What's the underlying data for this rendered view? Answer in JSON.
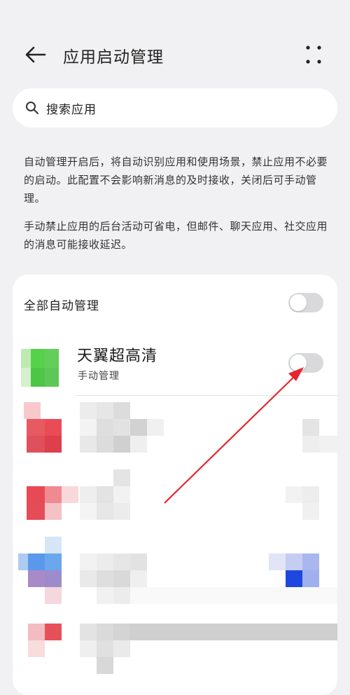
{
  "header": {
    "title": "应用启动管理",
    "back_icon": "arrow-left-icon",
    "more_icon": "more-dots-icon"
  },
  "search": {
    "placeholder": "搜索应用",
    "icon": "search-icon"
  },
  "description": {
    "paragraph1": "自动管理开启后，将自动识别应用和使用场景，禁止应用不必要的启动。此配置不会影响新消息的及时接收，关闭后可手动管理。",
    "paragraph2": "手动禁止应用的后台活动可省电，但邮件、聊天应用、社交应用的消息可能接收延迟。"
  },
  "auto_manage_all": {
    "label": "全部自动管理",
    "enabled": false
  },
  "apps": [
    {
      "name": "天翼超高清",
      "status": "手动管理",
      "enabled": false
    }
  ],
  "colors": {
    "background": "#f1f1f3",
    "card": "#ffffff",
    "toggle_off": "#d9d9dc",
    "arrow": "#e5262b"
  }
}
